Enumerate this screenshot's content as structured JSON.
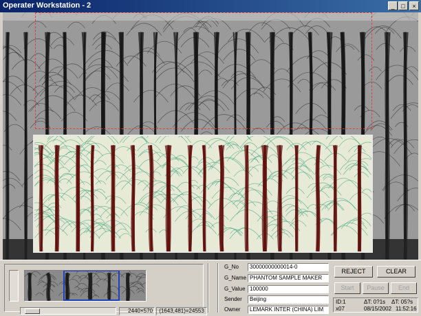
{
  "window": {
    "title": "Operater Workstation - 2",
    "buttons": [
      "_",
      "□",
      "×"
    ]
  },
  "thumbnail": {
    "status_size": "2440×570",
    "status_coords": "(1643,481)=24553"
  },
  "fields": [
    {
      "label": "G_No",
      "value": "30000000000014-0"
    },
    {
      "label": "G_Name",
      "value": "PHANTOM SAMPLE MAKER"
    },
    {
      "label": "G_Value",
      "value": "100000"
    },
    {
      "label": "Sender",
      "value": "Beijing"
    },
    {
      "label": "Owner",
      "value": "LEMARK INTER (CHINA) LIM"
    }
  ],
  "buttons": {
    "reject": "REJECT",
    "clear": "CLEAR",
    "start": "Start",
    "pause": "Pause",
    "end": "End"
  },
  "info": {
    "id": "ID:1",
    "dt1": "ΔT: 0?1s",
    "dt2": "ΔT: 05?s",
    "code": "x07",
    "date": "08/15/2002",
    "time": "11:52:16"
  },
  "colors": {
    "titlebar": "#0a246a",
    "scan_dark": "#1a1a1a",
    "inset_green": "#3aa27a",
    "inset_red": "#6b0f0a",
    "thumb_frame": "#1f3fbf"
  }
}
